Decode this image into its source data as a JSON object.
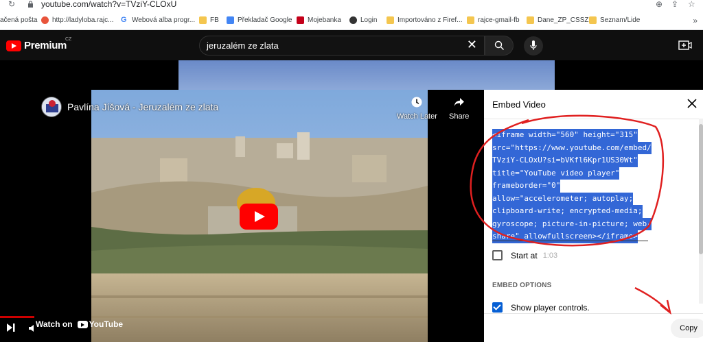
{
  "browser": {
    "url": "youtube.com/watch?v=TVziY-CLOxU",
    "bookmarks": [
      {
        "label": "ačená pošta",
        "icon": "mail-icon"
      },
      {
        "label": "http://ladyloba.rajc...",
        "icon": "site-icon"
      },
      {
        "label": "Webová alba progr...",
        "icon": "google-icon"
      },
      {
        "label": "FB",
        "icon": "folder-icon"
      },
      {
        "label": "Překladač Google",
        "icon": "translate-icon"
      },
      {
        "label": "Mojebanka",
        "icon": "bank-icon"
      },
      {
        "label": "Login",
        "icon": "globe-icon"
      },
      {
        "label": "Importováno z Firef...",
        "icon": "folder-icon"
      },
      {
        "label": "rajce-gmail-fb",
        "icon": "folder-icon"
      },
      {
        "label": "Dane_ZP_CSSZ",
        "icon": "folder-icon"
      },
      {
        "label": "Seznam/Lide",
        "icon": "folder-icon"
      }
    ],
    "more": "»"
  },
  "youtube": {
    "logo_text": "Premium",
    "region": "CZ",
    "search_query": "jeruzalém ze zlata"
  },
  "player": {
    "title": "Pavlína Jíšová - Jeruzalém ze zlata",
    "watch_later": "Watch Later",
    "share": "Share",
    "watch_on": "Watch on",
    "youtube_word": "YouTube"
  },
  "embed": {
    "title": "Embed Video",
    "code_lines": [
      "<iframe width=\"560\" height=\"315\"",
      "src=\"https://www.youtube.com/embed/",
      "TVziY-CLOxU?si=bVKfl6Kpr1US30Wt\"",
      "title=\"YouTube video player\"",
      "frameborder=\"0\"",
      "allow=\"accelerometer; autoplay;",
      "clipboard-write; encrypted-media;",
      "gyroscope; picture-in-picture; web-",
      "share\" allowfullscreen></iframe>"
    ],
    "start_at_label": "Start at",
    "start_at_time": "1:03",
    "options_heading": "EMBED OPTIONS",
    "show_controls_label": "Show player controls.",
    "show_controls_checked": true,
    "copy_label": "Copy"
  },
  "colors": {
    "yt_red": "#ff0000",
    "selection_blue": "#3367d6",
    "checkbox_blue": "#065fd4",
    "annotation_red": "#e02020"
  }
}
